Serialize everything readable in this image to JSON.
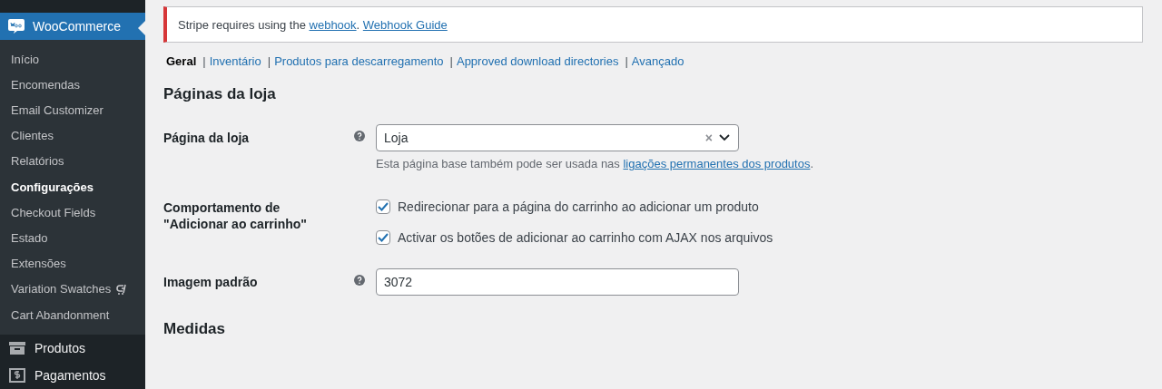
{
  "sidebar": {
    "header": {
      "label": "WooCommerce",
      "selected": true
    },
    "submenu": [
      {
        "label": "Início",
        "selected": false,
        "has_icon": false
      },
      {
        "label": "Encomendas",
        "selected": false,
        "has_icon": false
      },
      {
        "label": "Email Customizer",
        "selected": false,
        "has_icon": false
      },
      {
        "label": "Clientes",
        "selected": false,
        "has_icon": false
      },
      {
        "label": "Relatórios",
        "selected": false,
        "has_icon": false
      },
      {
        "label": "Configurações",
        "selected": true,
        "has_icon": false
      },
      {
        "label": "Checkout Fields",
        "selected": false,
        "has_icon": false
      },
      {
        "label": "Estado",
        "selected": false,
        "has_icon": false
      },
      {
        "label": "Extensões",
        "selected": false,
        "has_icon": false
      },
      {
        "label": "Variation Swatches",
        "selected": false,
        "has_icon": true
      },
      {
        "label": "Cart Abandonment",
        "selected": false,
        "has_icon": false
      }
    ],
    "menu": [
      {
        "label": "Produtos",
        "selected": false
      },
      {
        "label": "Pagamentos",
        "selected": false
      }
    ]
  },
  "notice": {
    "parts": [
      {
        "kind": "text",
        "text": "Stripe requires using the "
      },
      {
        "kind": "link",
        "text": "webhook"
      },
      {
        "kind": "text",
        "text": ". "
      },
      {
        "kind": "link",
        "text": "Webhook Guide"
      }
    ]
  },
  "tabs": [
    {
      "label": "Geral",
      "selected": true
    },
    {
      "label": "Inventário",
      "selected": false,
      "separator": "|"
    },
    {
      "label": "Produtos para descarregamento",
      "selected": false,
      "separator": "|"
    },
    {
      "label": "Approved download directories",
      "selected": false,
      "separator": "|"
    },
    {
      "label": "Avançado",
      "selected": false,
      "separator": "|"
    }
  ],
  "sections": [
    {
      "heading": "Páginas da loja",
      "rows": [
        {
          "kind": "select",
          "label": "Página da loja",
          "help": true,
          "value": "Loja",
          "clear": "×",
          "description": [
            {
              "kind": "text",
              "text": "Esta página base também pode ser usada nas "
            },
            {
              "kind": "link",
              "text": "ligações permanentes dos produtos"
            },
            {
              "kind": "text",
              "text": "."
            }
          ]
        },
        {
          "kind": "checkboxes",
          "label": "Comportamento de \"Adicionar ao carrinho\"",
          "help": false,
          "options": [
            {
              "label": "Redirecionar para a página do carrinho ao adicionar um produto",
              "checked": true
            },
            {
              "label": "Activar os botões de adicionar ao carrinho com AJAX nos arquivos",
              "checked": true
            }
          ]
        },
        {
          "kind": "text",
          "label": "Imagem padrão",
          "help": true,
          "value": "3072"
        }
      ]
    },
    {
      "heading": "Medidas"
    }
  ]
}
